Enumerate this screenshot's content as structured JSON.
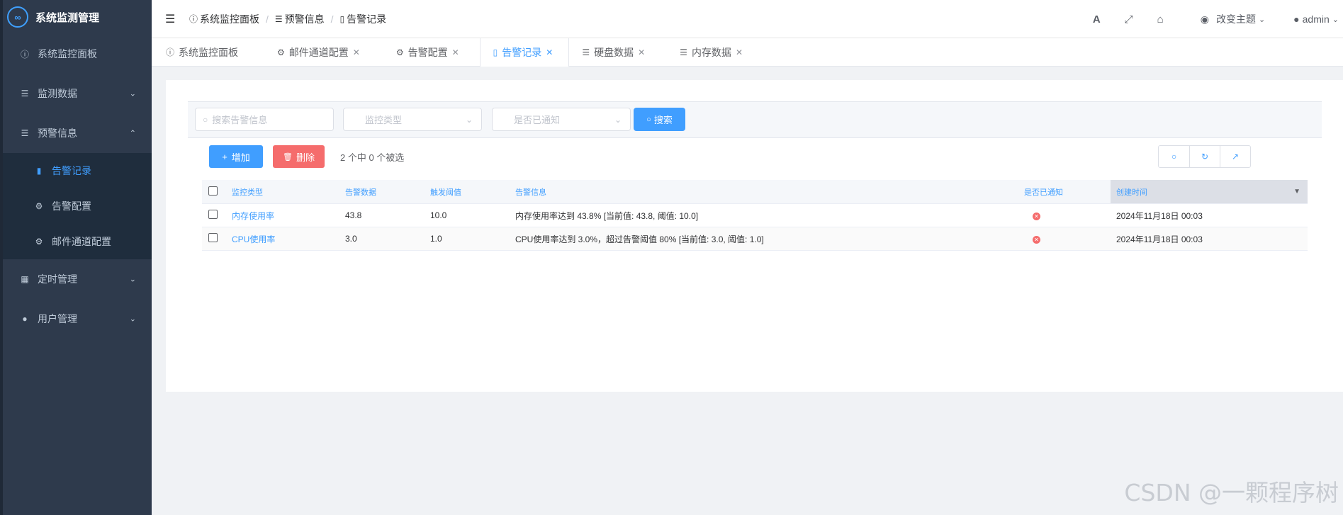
{
  "app": {
    "title": "系统监测管理",
    "logo_text": "∞"
  },
  "sidebar": {
    "items": [
      {
        "label": "系统监控面板",
        "icon": "info-circle-icon"
      },
      {
        "label": "监测数据",
        "icon": "database-icon"
      },
      {
        "label": "预警信息",
        "icon": "database-icon"
      },
      {
        "label": "定时管理",
        "icon": "calendar-icon"
      },
      {
        "label": "用户管理",
        "icon": "user-icon"
      }
    ],
    "sub_items": [
      {
        "label": "告警记录",
        "icon": "bookmark-icon"
      },
      {
        "label": "告警配置",
        "icon": "gear-icon"
      },
      {
        "label": "邮件通道配置",
        "icon": "gear-icon"
      }
    ]
  },
  "navbar": {
    "breadcrumb": [
      "系统监控面板",
      "预警信息",
      "告警记录"
    ],
    "theme_label": "改变主题",
    "user_label": "admin"
  },
  "tabs": [
    {
      "label": "系统监控面板",
      "closable": false
    },
    {
      "label": "邮件通道配置",
      "closable": true
    },
    {
      "label": "告警配置",
      "closable": true
    },
    {
      "label": "告警记录",
      "closable": true,
      "active": true
    },
    {
      "label": "硬盘数据",
      "closable": true
    },
    {
      "label": "内存数据",
      "closable": true
    }
  ],
  "search": {
    "keyword_placeholder": "搜索告警信息",
    "type_placeholder": "监控类型",
    "notified_placeholder": "是否已通知",
    "search_label": "搜索"
  },
  "toolbar": {
    "add_label": "增加",
    "delete_label": "删除",
    "selection_info": "2 个中 0 个被选"
  },
  "table": {
    "headers": [
      "监控类型",
      "告警数据",
      "触发阈值",
      "告警信息",
      "是否已通知",
      "创建时间"
    ],
    "rows": [
      {
        "type": "内存使用率",
        "data": "43.8",
        "threshold": "10.0",
        "message": "内存使用率达到 43.8% [当前值: 43.8, 阈值: 10.0]",
        "notified": false,
        "created": "2024年11月18日 00:03"
      },
      {
        "type": "CPU使用率",
        "data": "3.0",
        "threshold": "1.0",
        "message": "CPU使用率达到 3.0%，超过告警阈值 80% [当前值: 3.0, 阈值: 1.0]",
        "notified": false,
        "created": "2024年11月18日 00:03"
      }
    ]
  },
  "watermark": "CSDN @一颗程序树",
  "colors": {
    "accent": "#409eff",
    "danger": "#f56c6c",
    "sidebar": "#2e3a4c"
  }
}
